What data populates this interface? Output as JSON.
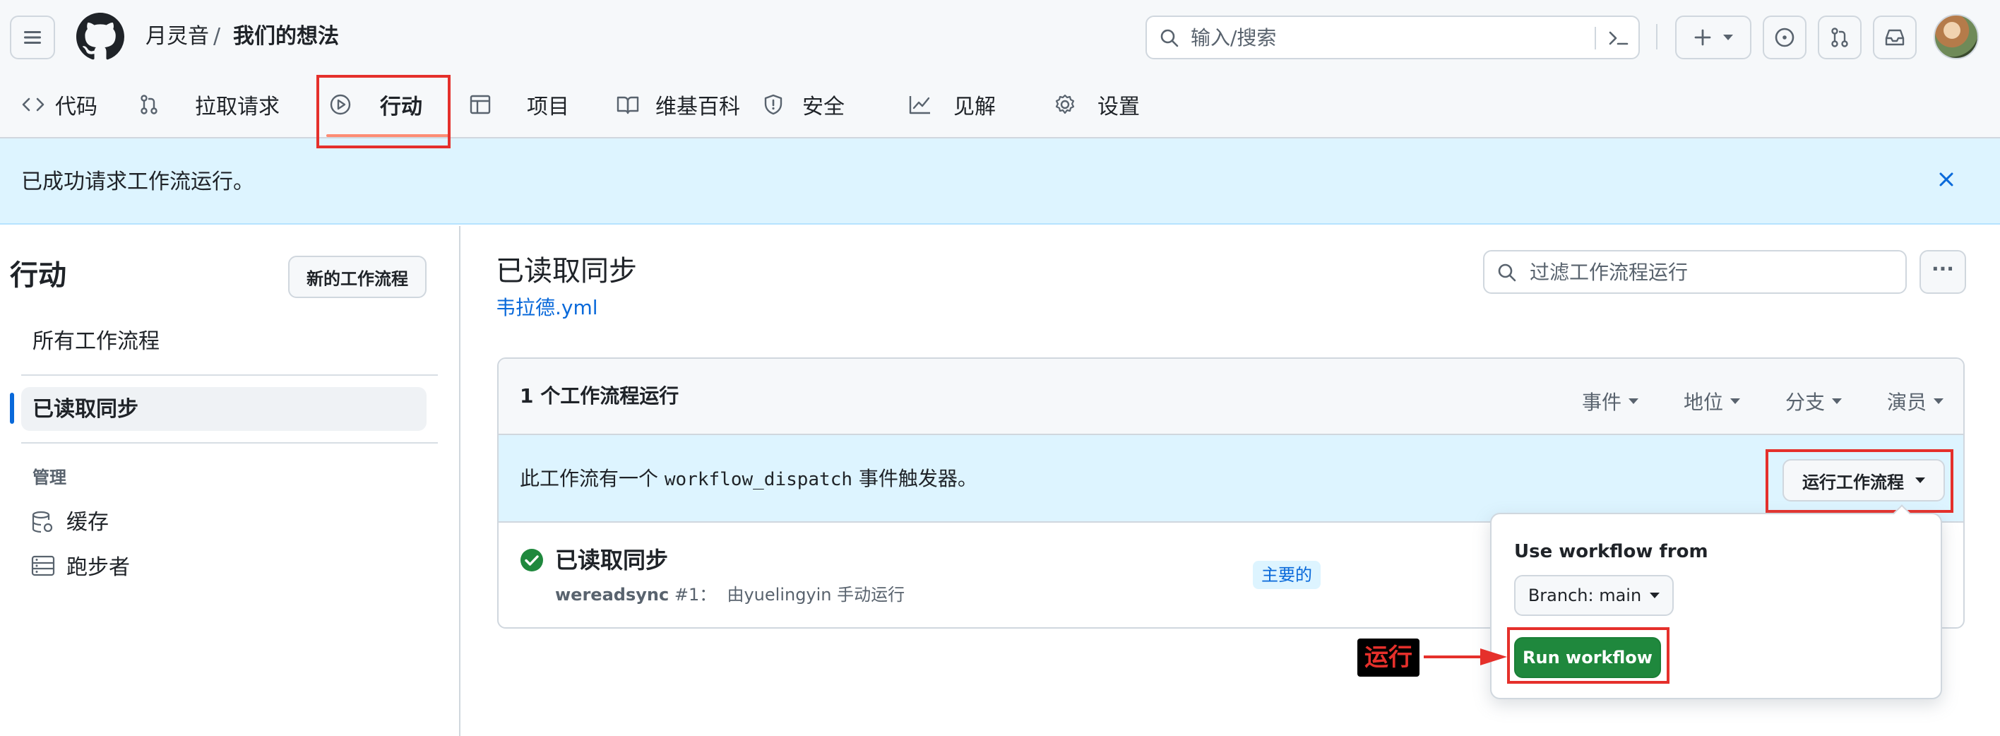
{
  "header": {
    "owner": "月灵音",
    "separator": "/",
    "repo": "我们的想法",
    "search_placeholder": "输入/搜索"
  },
  "tabs": [
    {
      "label": "代码"
    },
    {
      "label": "拉取请求"
    },
    {
      "label": "行动"
    },
    {
      "label": "项目"
    },
    {
      "label": "维基百科"
    },
    {
      "label": "安全"
    },
    {
      "label": "见解"
    },
    {
      "label": "设置"
    }
  ],
  "flash": {
    "message": "已成功请求工作流运行。"
  },
  "sidebar": {
    "title": "行动",
    "new_workflow_label": "新的工作流程",
    "all_workflows": "所有工作流程",
    "selected_workflow": "已读取同步",
    "manage_heading": "管理",
    "caches": "缓存",
    "runners": "跑步者"
  },
  "main": {
    "title": "已读取同步",
    "file_link": "韦拉德.yml",
    "filter_placeholder": "过滤工作流程运行",
    "more_label": "···",
    "count_label": "1 个工作流程运行",
    "filters": [
      "事件",
      "地位",
      "分支",
      "演员"
    ],
    "dispatch_prefix": "此工作流有一个 ",
    "dispatch_code": "workflow_dispatch",
    "dispatch_suffix": " 事件触发器。",
    "run_workflow_button": "运行工作流程",
    "run": {
      "title": "已读取同步",
      "workflow": "wereadsync",
      "number": "#1",
      "meta": "：  由yuelingyin 手动运行",
      "branch_badge": "主要的"
    }
  },
  "popover": {
    "heading": "Use workflow from",
    "branch_button": "Branch: main",
    "run_button": "Run workflow"
  },
  "annotation": {
    "label": "运行"
  },
  "colors": {
    "accent_blue": "#0969da",
    "green": "#1f883d",
    "annotation_red": "#e5302b",
    "flash_bg": "#ddf4ff"
  }
}
